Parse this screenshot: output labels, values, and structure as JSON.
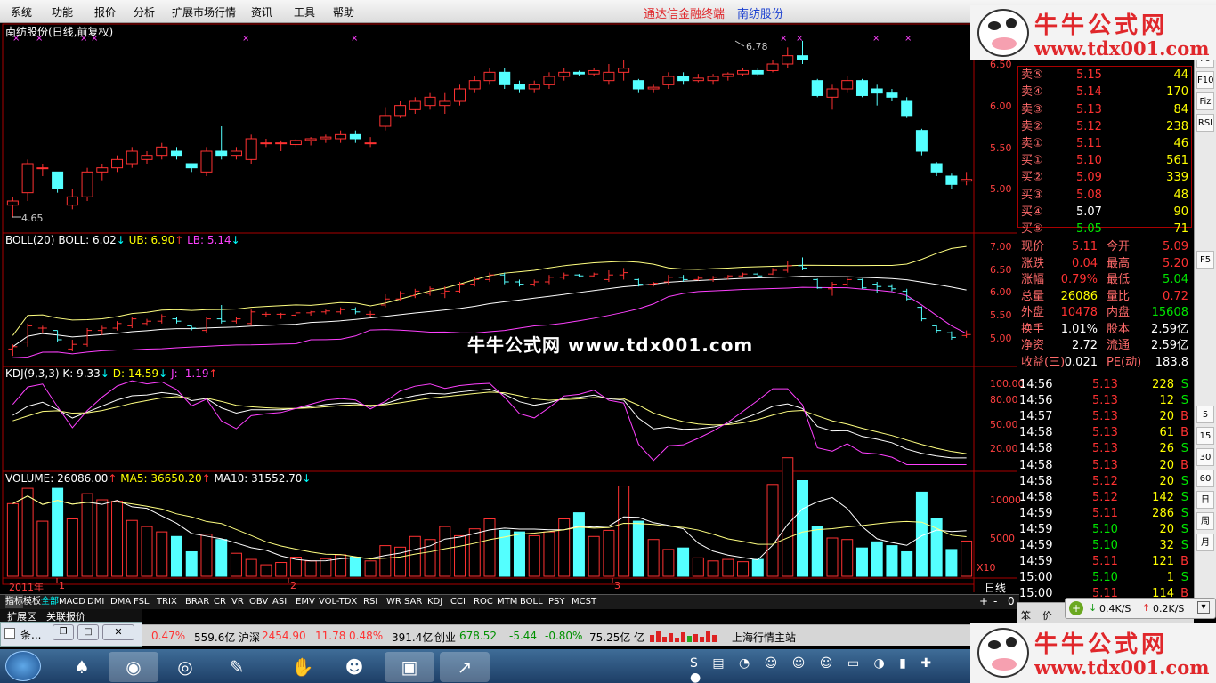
{
  "menu": [
    "系统",
    "功能",
    "报价",
    "分析",
    "扩展市场行情",
    "资讯",
    "工具",
    "帮助"
  ],
  "brand_text": "通达信金融终端",
  "stock_name_header": "南纺股份",
  "chart_title": "南纺股份(日线,前复权)",
  "high_marker": "6.78",
  "low_marker": "4.65",
  "boll_label": "BOLL(20)",
  "boll_val": "BOLL: 6.02",
  "ub_val": "UB: 6.90",
  "lb_val": "LB: 5.14",
  "kdj_label": "KDJ(9,3,3)",
  "k_val": "K: 9.33",
  "d_val": "D: 14.59",
  "j_val": "J: -1.19",
  "vol_label": "VOLUME: 26086.00",
  "ma5_val": "MA5: 36650.20",
  "ma10_val": "MA10: 31552.70",
  "price_axis": [
    "6.50",
    "6.00",
    "5.50",
    "5.00"
  ],
  "boll_axis": [
    "7.00",
    "6.50",
    "6.00",
    "5.50",
    "5.00"
  ],
  "kdj_axis": [
    "100.00",
    "80.00",
    "50.00",
    "20.00"
  ],
  "vol_axis": [
    "10000",
    "5000"
  ],
  "vol_unit": "X10",
  "time_labels": [
    "2011年",
    "1",
    "2",
    "3"
  ],
  "period": "日线",
  "center_watermark": "牛牛公式网 www.tdx001.com",
  "watermark": {
    "name": "牛牛公式网",
    "url": "www.tdx001.com"
  },
  "tabs": [
    "指标",
    "模板",
    "全部",
    "MACD",
    "DMI",
    "DMA",
    "FSL",
    "TRIX",
    "BRAR",
    "CR",
    "VR",
    "OBV",
    "ASI",
    "EMV",
    "VOL-TDX",
    "RSI",
    "WR",
    "SAR",
    "KDJ",
    "CCI",
    "ROC",
    "MTM",
    "BOLL",
    "PSY",
    "MCST"
  ],
  "sub_tabs": [
    "扩展区",
    "关联报价"
  ],
  "order_book": {
    "sells": [
      {
        "label": "卖⑤",
        "price": "5.15",
        "vol": "44"
      },
      {
        "label": "卖④",
        "price": "5.14",
        "vol": "170"
      },
      {
        "label": "卖③",
        "price": "5.13",
        "vol": "84"
      },
      {
        "label": "卖②",
        "price": "5.12",
        "vol": "238"
      },
      {
        "label": "卖①",
        "price": "5.11",
        "vol": "46"
      }
    ],
    "buys": [
      {
        "label": "买①",
        "price": "5.10",
        "vol": "561"
      },
      {
        "label": "买②",
        "price": "5.09",
        "vol": "339"
      },
      {
        "label": "买③",
        "price": "5.08",
        "vol": "48"
      },
      {
        "label": "买④",
        "price": "5.07",
        "vol": "90"
      },
      {
        "label": "买⑤",
        "price": "5.05",
        "vol": "71"
      }
    ]
  },
  "quote": [
    {
      "l1": "现价",
      "v1": "5.11",
      "l2": "今开",
      "v2": "5.09"
    },
    {
      "l1": "涨跌",
      "v1": "0.04",
      "l2": "最高",
      "v2": "5.20"
    },
    {
      "l1": "涨幅",
      "v1": "0.79%",
      "l2": "最低",
      "v2": "5.04"
    },
    {
      "l1": "总量",
      "v1": "26086",
      "l2": "量比",
      "v2": "0.72"
    },
    {
      "l1": "外盘",
      "v1": "10478",
      "l2": "内盘",
      "v2": "15608"
    },
    {
      "l1": "换手",
      "v1": "1.01%",
      "l2": "股本",
      "v2": "2.59亿"
    },
    {
      "l1": "净资",
      "v1": "2.72",
      "l2": "流通",
      "v2": "2.59亿"
    },
    {
      "l1": "收益(三)",
      "v1": "0.021",
      "l2": "PE(动)",
      "v2": "183.8"
    }
  ],
  "ticks": [
    [
      "14:56",
      "5.13",
      "228",
      "S"
    ],
    [
      "14:56",
      "5.13",
      "12",
      "S"
    ],
    [
      "14:57",
      "5.13",
      "20",
      "B"
    ],
    [
      "14:58",
      "5.13",
      "61",
      "B"
    ],
    [
      "14:58",
      "5.13",
      "26",
      "S"
    ],
    [
      "14:58",
      "5.13",
      "20",
      "B"
    ],
    [
      "14:58",
      "5.12",
      "20",
      "S"
    ],
    [
      "14:58",
      "5.12",
      "142",
      "S"
    ],
    [
      "14:59",
      "5.11",
      "286",
      "S"
    ],
    [
      "14:59",
      "5.10",
      "20",
      "S"
    ],
    [
      "14:59",
      "5.10",
      "32",
      "S"
    ],
    [
      "14:59",
      "5.11",
      "121",
      "B"
    ],
    [
      "15:00",
      "5.10",
      "1",
      "S"
    ],
    [
      "15:00",
      "5.11",
      "114",
      "B"
    ]
  ],
  "net_speed": [
    "0.4K/S",
    "0.2K/S"
  ],
  "index_bar": {
    "pct1": "0.47%",
    "amt1": "559.6亿",
    "sz_label": "沪深",
    "sz_val": "2454.90",
    "sz_chg": "11.78",
    "sz_pct": "0.48%",
    "sz_amt": "391.4亿",
    "cy_label": "创业",
    "cy_val": "678.52",
    "cy_chg": "-5.44",
    "cy_pct": "-0.80%",
    "cy_amt": "75.25亿",
    "cy_unit": "亿",
    "station": "上海行情主站"
  },
  "small_window_title": "条...",
  "toolstrip": [
    "Fo",
    "F10",
    "Fiz",
    "RSI",
    "F5",
    "5",
    "15",
    "30",
    "60",
    "日",
    "周",
    "月"
  ],
  "bottom_right": [
    "笨",
    "价"
  ],
  "chart_data": {
    "type": "candlestick",
    "candles": [
      [
        4.8,
        4.9,
        4.65,
        4.85
      ],
      [
        4.95,
        5.35,
        4.85,
        5.3
      ],
      [
        5.25,
        5.3,
        5.15,
        5.25
      ],
      [
        5.2,
        5.2,
        4.95,
        5.0
      ],
      [
        4.8,
        5.0,
        4.75,
        4.9
      ],
      [
        4.9,
        5.25,
        4.85,
        5.2
      ],
      [
        5.2,
        5.3,
        5.1,
        5.25
      ],
      [
        5.25,
        5.4,
        5.2,
        5.35
      ],
      [
        5.3,
        5.5,
        5.25,
        5.45
      ],
      [
        5.35,
        5.45,
        5.3,
        5.4
      ],
      [
        5.4,
        5.55,
        5.35,
        5.5
      ],
      [
        5.45,
        5.5,
        5.35,
        5.4
      ],
      [
        5.3,
        5.3,
        5.2,
        5.25
      ],
      [
        5.2,
        5.5,
        5.15,
        5.45
      ],
      [
        5.45,
        5.75,
        5.35,
        5.4
      ],
      [
        5.4,
        5.5,
        5.35,
        5.45
      ],
      [
        5.35,
        5.65,
        5.3,
        5.6
      ],
      [
        5.55,
        5.6,
        5.5,
        5.55
      ],
      [
        5.55,
        5.58,
        5.45,
        5.55
      ],
      [
        5.53,
        5.6,
        5.5,
        5.58
      ],
      [
        5.58,
        5.62,
        5.52,
        5.6
      ],
      [
        5.6,
        5.65,
        5.55,
        5.62
      ],
      [
        5.6,
        5.7,
        5.55,
        5.65
      ],
      [
        5.65,
        5.7,
        5.55,
        5.6
      ],
      [
        5.55,
        5.62,
        5.5,
        5.55
      ],
      [
        5.75,
        5.98,
        5.7,
        5.88
      ],
      [
        5.88,
        6.05,
        5.85,
        6.0
      ],
      [
        5.95,
        6.1,
        5.9,
        6.05
      ],
      [
        6.0,
        6.15,
        5.95,
        6.1
      ],
      [
        6.0,
        6.15,
        5.9,
        6.05
      ],
      [
        6.05,
        6.25,
        6.0,
        6.2
      ],
      [
        6.2,
        6.35,
        6.15,
        6.3
      ],
      [
        6.3,
        6.45,
        6.25,
        6.4
      ],
      [
        6.4,
        6.45,
        6.2,
        6.25
      ],
      [
        6.25,
        6.3,
        6.15,
        6.2
      ],
      [
        6.2,
        6.3,
        6.15,
        6.25
      ],
      [
        6.25,
        6.4,
        6.2,
        6.35
      ],
      [
        6.35,
        6.45,
        6.3,
        6.4
      ],
      [
        6.4,
        6.42,
        6.35,
        6.38
      ],
      [
        6.38,
        6.45,
        6.35,
        6.42
      ],
      [
        6.3,
        6.5,
        6.25,
        6.4
      ],
      [
        6.4,
        6.55,
        6.3,
        6.45
      ],
      [
        6.3,
        6.32,
        6.15,
        6.2
      ],
      [
        6.2,
        6.25,
        6.15,
        6.22
      ],
      [
        6.25,
        6.4,
        6.2,
        6.35
      ],
      [
        6.35,
        6.4,
        6.25,
        6.3
      ],
      [
        6.3,
        6.38,
        6.28,
        6.33
      ],
      [
        6.3,
        6.38,
        6.25,
        6.35
      ],
      [
        6.35,
        6.4,
        6.3,
        6.38
      ],
      [
        6.38,
        6.45,
        6.35,
        6.42
      ],
      [
        6.42,
        6.45,
        6.35,
        6.38
      ],
      [
        6.42,
        6.55,
        6.4,
        6.5
      ],
      [
        6.5,
        6.7,
        6.45,
        6.6
      ],
      [
        6.6,
        6.78,
        6.5,
        6.55
      ],
      [
        6.3,
        6.32,
        6.1,
        6.12
      ],
      [
        6.1,
        6.25,
        5.95,
        6.2
      ],
      [
        6.2,
        6.35,
        6.15,
        6.3
      ],
      [
        6.3,
        6.32,
        6.1,
        6.12
      ],
      [
        6.2,
        6.25,
        6.0,
        6.15
      ],
      [
        6.15,
        6.2,
        6.05,
        6.1
      ],
      [
        6.05,
        6.1,
        5.85,
        5.88
      ],
      [
        5.7,
        5.72,
        5.4,
        5.45
      ],
      [
        5.3,
        5.32,
        5.15,
        5.2
      ],
      [
        5.15,
        5.18,
        5.0,
        5.05
      ],
      [
        5.09,
        5.2,
        5.04,
        5.11
      ]
    ],
    "volume": [
      9.5,
      11.5,
      7.2,
      11.5,
      7.5,
      10.8,
      10.0,
      9.8,
      7.3,
      6.5,
      5.8,
      5.2,
      3.2,
      5.5,
      4.8,
      3.0,
      2.2,
      1.5,
      1.8,
      2.5,
      2.0,
      2.3,
      2.8,
      2.5,
      2.0,
      4.0,
      3.8,
      5.2,
      4.8,
      6.5,
      5.3,
      6.2,
      7.5,
      6.0,
      5.8,
      5.3,
      5.8,
      7.5,
      8.3,
      5.2,
      6.0,
      11.8,
      7.2,
      4.8,
      3.5,
      3.7,
      2.4,
      2.0,
      2.2,
      1.9,
      2.2,
      12.0,
      15.5,
      12.5,
      6.5,
      5.0,
      4.8,
      3.7,
      4.5,
      4.0,
      3.2,
      11.0,
      7.5,
      3.5,
      4.6
    ],
    "boll": {
      "mid": "20",
      "ub": "6.90",
      "lb": "5.14"
    },
    "kdj": {
      "k": "9.33",
      "d": "14.59",
      "j": "-1.19"
    }
  }
}
